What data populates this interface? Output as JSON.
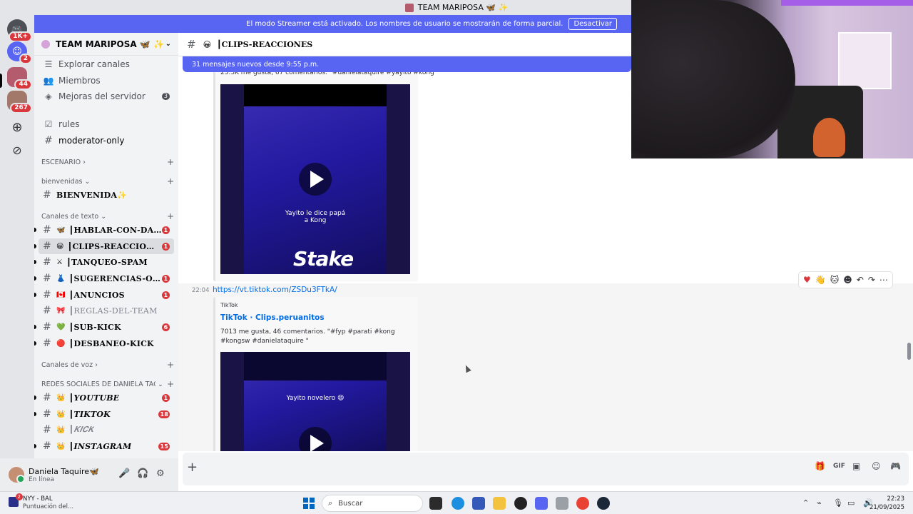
{
  "window": {
    "title": "TEAM MARIPOSA 🦋 ✨"
  },
  "rail": {
    "badges": [
      "1K+",
      "2",
      "44",
      "267"
    ]
  },
  "banner": {
    "text": "El modo Streamer está activado. Los nombres de usuario se mostrarán de forma parcial.",
    "button": "Desactivar"
  },
  "server": {
    "name": "TEAM MARIPOSA 🦋 ✨",
    "nav": [
      {
        "label": "Explorar canales",
        "icon": "compass-icon"
      },
      {
        "label": "Miembros",
        "icon": "members-icon"
      },
      {
        "label": "Mejoras del servidor",
        "icon": "boost-icon",
        "count": "3"
      }
    ]
  },
  "sidebar": {
    "rules": "rules",
    "moderator": "moderator-only",
    "categories": {
      "escenario": "ESCENARIO",
      "bienvenidas": "bienvenidas",
      "texto": "Canales de texto",
      "voz": "Canales de voz",
      "redes": "REDES SOCIALES DE DANIELA TAQU..."
    },
    "channels": [
      {
        "emoji": "",
        "name": "BIENVENIDA✨",
        "badge": ""
      },
      {
        "emoji": "🦋",
        "name": "┃HABLAR-CON-DA...",
        "badge": "1"
      },
      {
        "emoji": "😀",
        "name": "┃CLIPS-REACCIONES",
        "badge": "1"
      },
      {
        "emoji": "⚔",
        "name": "┃TANQUEO-SPAM",
        "badge": ""
      },
      {
        "emoji": "👗",
        "name": "┃SUGERENCIAS-OU...",
        "badge": "1"
      },
      {
        "emoji": "🇨🇦",
        "name": "┃ANUNCIOS",
        "badge": "1"
      },
      {
        "emoji": "🎀",
        "name": "┃REGLAS-DEL-TEAM",
        "badge": ""
      },
      {
        "emoji": "💚",
        "name": "┃SUB-KICK",
        "badge": "6"
      },
      {
        "emoji": "🔴",
        "name": "┃DESBANEO-KICK",
        "badge": ""
      }
    ],
    "social": [
      {
        "emoji": "👑",
        "name": "┃𝒀𝑶𝑼𝑻𝑼𝑩𝑬",
        "badge": "1"
      },
      {
        "emoji": "👑",
        "name": "┃𝑻𝑰𝑲𝑻𝑶𝑲",
        "badge": "18"
      },
      {
        "emoji": "👑",
        "name": "┃𝑲𝑰𝑪𝑲",
        "badge": ""
      },
      {
        "emoji": "👑",
        "name": "┃𝑰𝑵𝑺𝑻𝑨𝑮𝑹𝑨𝑴",
        "badge": "15"
      }
    ]
  },
  "user": {
    "name": "Daniela Taquire🦋",
    "status": "En línea"
  },
  "channel": {
    "emoji": "😀",
    "name": "┃CLIPS-REACCIONES"
  },
  "chat": {
    "new_messages": "31 mensajes nuevos desde 9:55 p.m.",
    "top_embed_desc": "25.3K me gusta, 67 comentarios. \"#danielataquire #yayito #kong\"",
    "video1": {
      "caption": "Yayito le dice papá\na Kong",
      "brand": "Stake"
    },
    "message": {
      "time": "22:04",
      "link": "https://vt.tiktok.com/ZSDu3FTkA/",
      "provider": "TikTok",
      "title": "TikTok · Clips.peruanitos",
      "description": "7013 me gusta, 46 comentarios. \"#fyp #parati #kong #kongsw #danielataquire \""
    },
    "video2": {
      "caption": "Yayito novelero 😄"
    }
  },
  "taskbar": {
    "weather_title": "NYY - BAL",
    "weather_sub": "Puntuación del...",
    "weather_badge": "2",
    "search_placeholder": "Buscar",
    "time": "22:23",
    "date": "21/09/2025"
  }
}
